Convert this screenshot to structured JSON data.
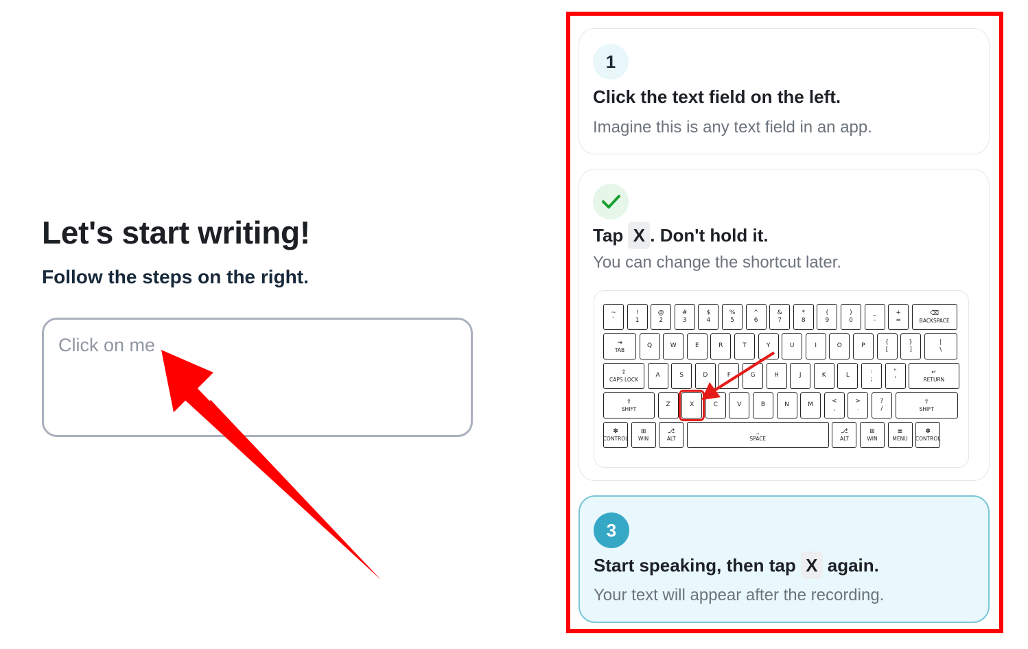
{
  "left": {
    "title": "Let's start writing!",
    "subtitle": "Follow the steps on the right.",
    "field_placeholder": "Click on me"
  },
  "steps": [
    {
      "badge": "1",
      "state": "pending",
      "title": "Click the text field on the left.",
      "description": "Imagine this is any text field in an app."
    },
    {
      "badge": "✓",
      "state": "done",
      "title_before": "Tap",
      "key": "X",
      "title_after": ". Don't hold it.",
      "description": "You can change the shortcut later."
    },
    {
      "badge": "3",
      "state": "current",
      "title_before": "Start speaking, then tap",
      "key": "X",
      "title_after": "again.",
      "description": "Your text will appear after the recording."
    }
  ],
  "keyboard": {
    "highlighted_key": "X",
    "rows": [
      [
        [
          "~",
          "`"
        ],
        [
          "!",
          "1"
        ],
        [
          "@",
          "2"
        ],
        [
          "#",
          "3"
        ],
        [
          "$",
          "4"
        ],
        [
          "%",
          "5"
        ],
        [
          "^",
          "6"
        ],
        [
          "&",
          "7"
        ],
        [
          "*",
          "8"
        ],
        [
          "(",
          "9"
        ],
        [
          ")",
          "0"
        ],
        [
          "_",
          "-"
        ],
        [
          "+",
          "="
        ],
        [
          "⌫",
          "BACKSPACE"
        ]
      ],
      [
        [
          "⇥",
          "TAB"
        ],
        [
          "",
          "Q"
        ],
        [
          "",
          "W"
        ],
        [
          "",
          "E"
        ],
        [
          "",
          "R"
        ],
        [
          "",
          "T"
        ],
        [
          "",
          "Y"
        ],
        [
          "",
          "U"
        ],
        [
          "",
          "I"
        ],
        [
          "",
          "O"
        ],
        [
          "",
          "P"
        ],
        [
          "{",
          "["
        ],
        [
          "}",
          "]"
        ],
        [
          "|",
          "\\"
        ]
      ],
      [
        [
          "⇪",
          "CAPS LOCK"
        ],
        [
          "",
          "A"
        ],
        [
          "",
          "S"
        ],
        [
          "",
          "D"
        ],
        [
          "",
          "F"
        ],
        [
          "",
          "G"
        ],
        [
          "",
          "H"
        ],
        [
          "",
          "J"
        ],
        [
          "",
          "K"
        ],
        [
          "",
          "L"
        ],
        [
          ":",
          ";"
        ],
        [
          "\"",
          "'"
        ],
        [
          "↵",
          "RETURN"
        ]
      ],
      [
        [
          "⇧",
          "SHIFT"
        ],
        [
          "",
          "Z"
        ],
        [
          "",
          "X"
        ],
        [
          "",
          "C"
        ],
        [
          "",
          "V"
        ],
        [
          "",
          "B"
        ],
        [
          "",
          "N"
        ],
        [
          "",
          "M"
        ],
        [
          "<",
          ","
        ],
        [
          ">",
          "."
        ],
        [
          "?",
          "/"
        ],
        [
          "⇧",
          "SHIFT"
        ]
      ],
      [
        [
          "✽",
          "CONTROL"
        ],
        [
          "⊞",
          "WIN"
        ],
        [
          "⎇",
          "ALT"
        ],
        [
          "⎵",
          "SPACE"
        ],
        [
          "⎇",
          "ALT"
        ],
        [
          "⊞",
          "WIN"
        ],
        [
          "≣",
          "MENU"
        ],
        [
          "✽",
          "CONTROL"
        ]
      ]
    ]
  },
  "colors": {
    "annotation_red": "#ff0000",
    "active_card_bg": "#e9f8fc",
    "badge_current": "#35a8c6",
    "check_green": "#18a02f"
  }
}
